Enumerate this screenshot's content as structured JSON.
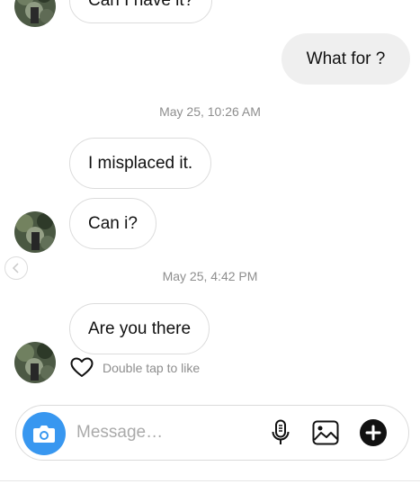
{
  "conversation": {
    "messages": [
      {
        "direction": "incoming",
        "text": "Can I have it?"
      },
      {
        "direction": "outgoing",
        "text": "What for ?"
      },
      {
        "direction": "incoming",
        "text": "I misplaced it."
      },
      {
        "direction": "incoming",
        "text": "Can i?"
      },
      {
        "direction": "incoming",
        "text": "Are you there"
      }
    ],
    "timestamps": [
      "May 25, 10:26 AM",
      "May 25, 4:42 PM"
    ],
    "like_hint": "Double tap to like"
  },
  "composer": {
    "placeholder": "Message…",
    "icons": [
      "camera-icon",
      "microphone-icon",
      "gallery-icon",
      "add-icon"
    ],
    "accent_color": "#3897f0"
  },
  "colors": {
    "outgoing_bubble": "#efefef",
    "incoming_border": "#dcdcdc",
    "timestamp": "#8e8e8e"
  }
}
